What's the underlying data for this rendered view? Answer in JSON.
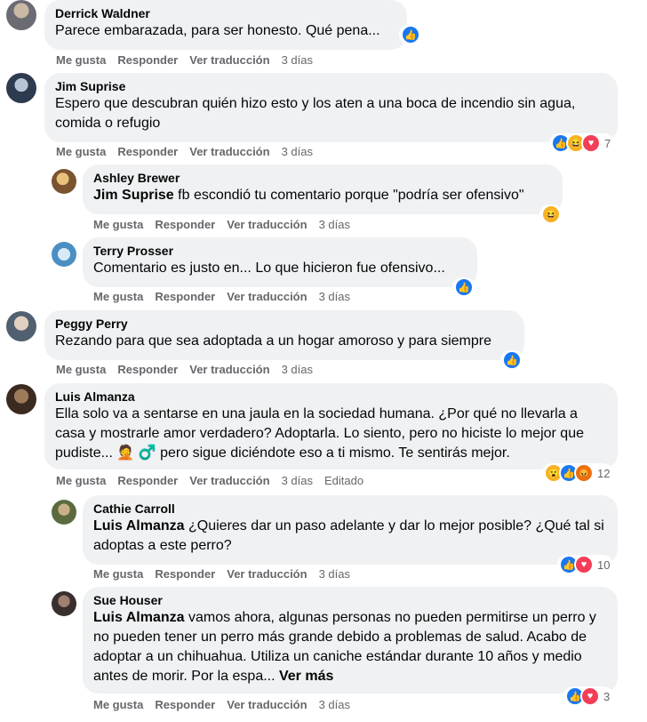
{
  "actions": {
    "like": "Me gusta",
    "reply": "Responder",
    "translate": "Ver traducción",
    "edited": "Editado"
  },
  "comments": [
    {
      "author": "Derrick Waldner",
      "text": "Parece embarazada, para ser honesto. Qué pena...",
      "time": "3 días"
    },
    {
      "author": "Jim Suprise",
      "text": "Espero que descubran quién hizo esto y los aten a una boca de incendio sin agua, comida o refugio",
      "time": "3 días",
      "reaction_count": "7"
    },
    {
      "author": "Ashley Brewer",
      "mention": "Jim Suprise",
      "text": " fb escondió tu comentario porque \"podría ser ofensivo\"",
      "time": "3 días"
    },
    {
      "author": "Terry Prosser",
      "text": "Comentario es justo en... Lo que hicieron fue ofensivo...",
      "time": "3 días"
    },
    {
      "author": "Peggy Perry",
      "text": "Rezando para que sea adoptada a un hogar amoroso y para siempre",
      "time": "3 días"
    },
    {
      "author": "Luis Almanza",
      "text": "Ella solo va a sentarse en una jaula en la sociedad humana. ¿Por qué no llevarla a casa y mostrarle amor verdadero? Adoptarla. Lo siento, pero no hiciste lo mejor que pudiste... 🤦 ♂️ pero sigue diciéndote eso a ti mismo. Te sentirás mejor.",
      "time": "3 días",
      "reaction_count": "12"
    },
    {
      "author": "Cathie Carroll",
      "mention": "Luis Almanza",
      "text": " ¿Quieres dar un paso adelante y dar lo mejor posible? ¿Qué tal si adoptas a este perro?",
      "time": "3 días",
      "reaction_count": "10"
    },
    {
      "author": "Sue Houser",
      "mention": "Luis Almanza",
      "text": " vamos ahora, algunas personas no pueden permitirse un perro y no pueden tener un perro más grande debido a problemas de salud. Acabo de adoptar a un chihuahua. Utiliza un caniche estándar durante 10 años y medio antes de morir. Por la espa...",
      "more": " Ver más",
      "time": "3 días",
      "reaction_count": "3"
    }
  ],
  "colors": {
    "bubble": "#eff1f3",
    "like": "#1877f2",
    "love": "#f33e58",
    "haha": "#f7b125",
    "meta": "#65676b"
  },
  "reaction_icons": {
    "like": "👍",
    "love": "♥",
    "haha": "😆",
    "wow": "😮",
    "angry": "😡"
  }
}
